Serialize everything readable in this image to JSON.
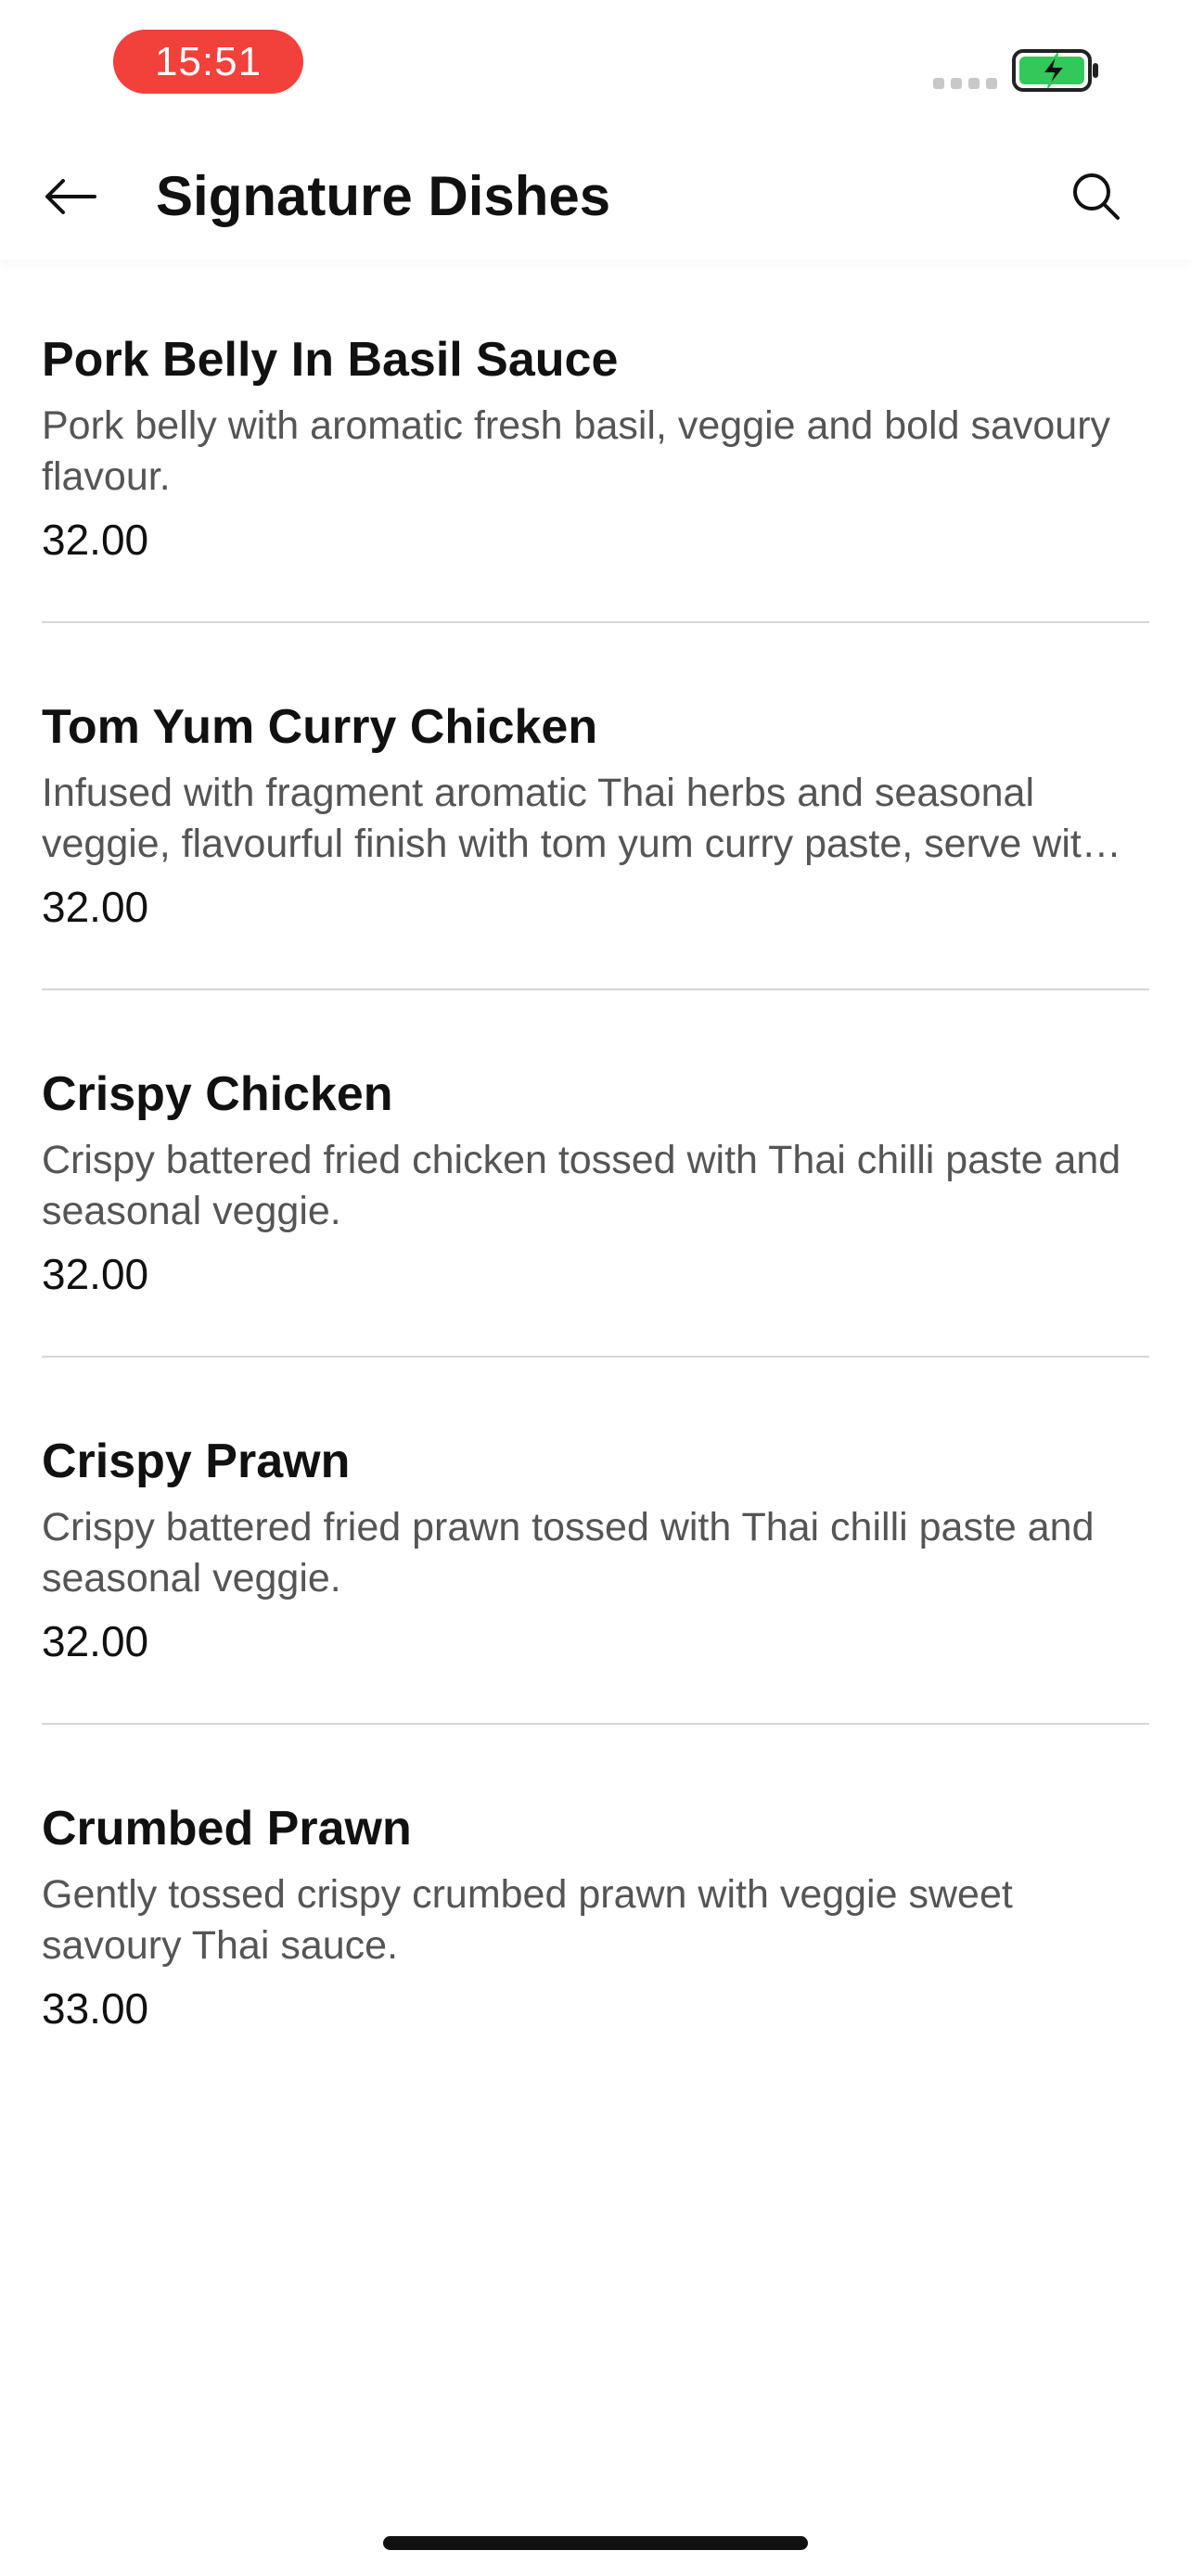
{
  "status_bar": {
    "time": "15:51",
    "signal_icon": "signal-dots-icon",
    "battery_icon": "battery-charging-icon",
    "battery_color": "#34c759"
  },
  "header": {
    "title": "Signature Dishes",
    "back_icon": "arrow-left-icon",
    "search_icon": "search-icon"
  },
  "menu": {
    "items": [
      {
        "name": "Pork Belly In Basil Sauce",
        "description": "Pork belly with aromatic fresh basil, veggie and bold savoury flavour.",
        "price": "32.00"
      },
      {
        "name": "Tom Yum Curry Chicken",
        "description": "Infused with fragment aromatic Thai herbs and seasonal veggie, flavourful finish with tom yum curry paste, serve wit…",
        "price": "32.00"
      },
      {
        "name": "Crispy Chicken",
        "description": "Crispy battered fried chicken tossed with Thai chilli paste and seasonal veggie.",
        "price": "32.00"
      },
      {
        "name": "Crispy Prawn",
        "description": "Crispy battered fried prawn tossed with Thai chilli paste and seasonal veggie.",
        "price": "32.00"
      },
      {
        "name": "Crumbed Prawn",
        "description": "Gently tossed crispy crumbed prawn with veggie sweet savoury Thai sauce.",
        "price": "33.00"
      }
    ]
  },
  "colors": {
    "time_pill": "#f2403a",
    "text_primary": "#111111",
    "text_secondary": "#555555",
    "divider": "#d6d6d6"
  }
}
